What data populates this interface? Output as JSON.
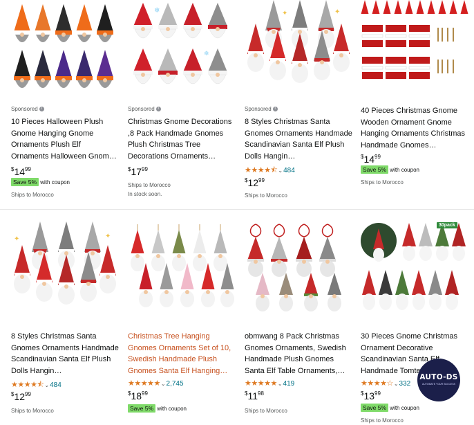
{
  "products": [
    {
      "sponsored": "Sponsored",
      "title": "10 Pieces Halloween Plush Gnome Hanging Gnome Ornaments Plush Elf Ornaments Halloween Gnom…",
      "price": {
        "symbol": "$",
        "whole": "14",
        "fraction": "99"
      },
      "coupon": {
        "badge": "Save 5%",
        "text": "with coupon"
      },
      "shipping": [
        "Ships to Morocco"
      ],
      "image_icon": "halloween-gnomes"
    },
    {
      "sponsored": "Sponsored",
      "title": "Christmas Gnome Decorations ,8 Pack Handmade Gnomes Plush Christmas Tree Decorations Ornaments…",
      "price": {
        "symbol": "$",
        "whole": "17",
        "fraction": "99"
      },
      "shipping": [
        "Ships to Morocco",
        "In stock soon."
      ],
      "image_icon": "christmas-gnomes"
    },
    {
      "sponsored": "Sponsored",
      "title": "8 Styles Christmas Santa Gnomes Ornaments Handmade Scandinavian Santa Elf Plush Dolls Hangin…",
      "rating": {
        "stars": 4.5,
        "count": "484"
      },
      "price": {
        "symbol": "$",
        "whole": "12",
        "fraction": "99"
      },
      "shipping": [
        "Ships to Morocco"
      ],
      "image_icon": "scandinavian-gnomes"
    },
    {
      "title": "40 Pieces Christmas Gnome Wooden Ornament Gnome Hanging Ornaments Christmas Handmade Gnomes…",
      "price": {
        "symbol": "$",
        "whole": "14",
        "fraction": "99"
      },
      "coupon": {
        "badge": "Save 5%",
        "text": "with coupon"
      },
      "shipping": [
        "Ships to Morocco"
      ],
      "image_icon": "wooden-gnome-ornaments"
    },
    {
      "title": "8 Styles Christmas Santa Gnomes Ornaments Handmade Scandinavian Santa Elf Plush Dolls Hangin…",
      "rating": {
        "stars": 4.5,
        "count": "484"
      },
      "price": {
        "symbol": "$",
        "whole": "12",
        "fraction": "99"
      },
      "shipping": [
        "Ships to Morocco"
      ],
      "image_icon": "scandinavian-gnomes"
    },
    {
      "title": "Christmas Tree Hanging Gnomes Ornaments Set of 10, Swedish Handmade Plush Gnomes Santa Elf Hanging…",
      "highlight": true,
      "rating": {
        "stars": 5,
        "count": "2,745"
      },
      "price": {
        "symbol": "$",
        "whole": "18",
        "fraction": "99"
      },
      "coupon": {
        "badge": "Save 5%",
        "text": "with coupon"
      },
      "image_icon": "swedish-gnomes"
    },
    {
      "title": "obmwang 8 Pack Christmas Gnomes Ornaments, Swedish Handmade Plush Gnomes Santa Elf Table Ornaments,…",
      "rating": {
        "stars": 5,
        "count": "419"
      },
      "price": {
        "symbol": "$",
        "whole": "11",
        "fraction": "98"
      },
      "shipping": [
        "Ships to Morocco"
      ],
      "image_icon": "obmwang-gnomes"
    },
    {
      "title": "30 Pieces Gnome Christmas Ornament Decorative Scandinavian Santa Elf Handmade Tomte…",
      "rating": {
        "stars": 4,
        "count": "332"
      },
      "price": {
        "symbol": "$",
        "whole": "13",
        "fraction": "99"
      },
      "coupon": {
        "badge": "Save 5%",
        "text": "with coupon"
      },
      "shipping": [
        "Ships to Morocco"
      ],
      "image_icon": "buffalo-plaid-gnomes",
      "pack_badge": "30pack"
    }
  ],
  "watermark": {
    "title": "AUTO-DS",
    "tagline": "AUTOMATE YOUR SUCCESS"
  },
  "colors": {
    "link": "#007185",
    "star": "#de7921",
    "coupon_badge": "#7fda69",
    "highlight_title": "#c7511f"
  }
}
